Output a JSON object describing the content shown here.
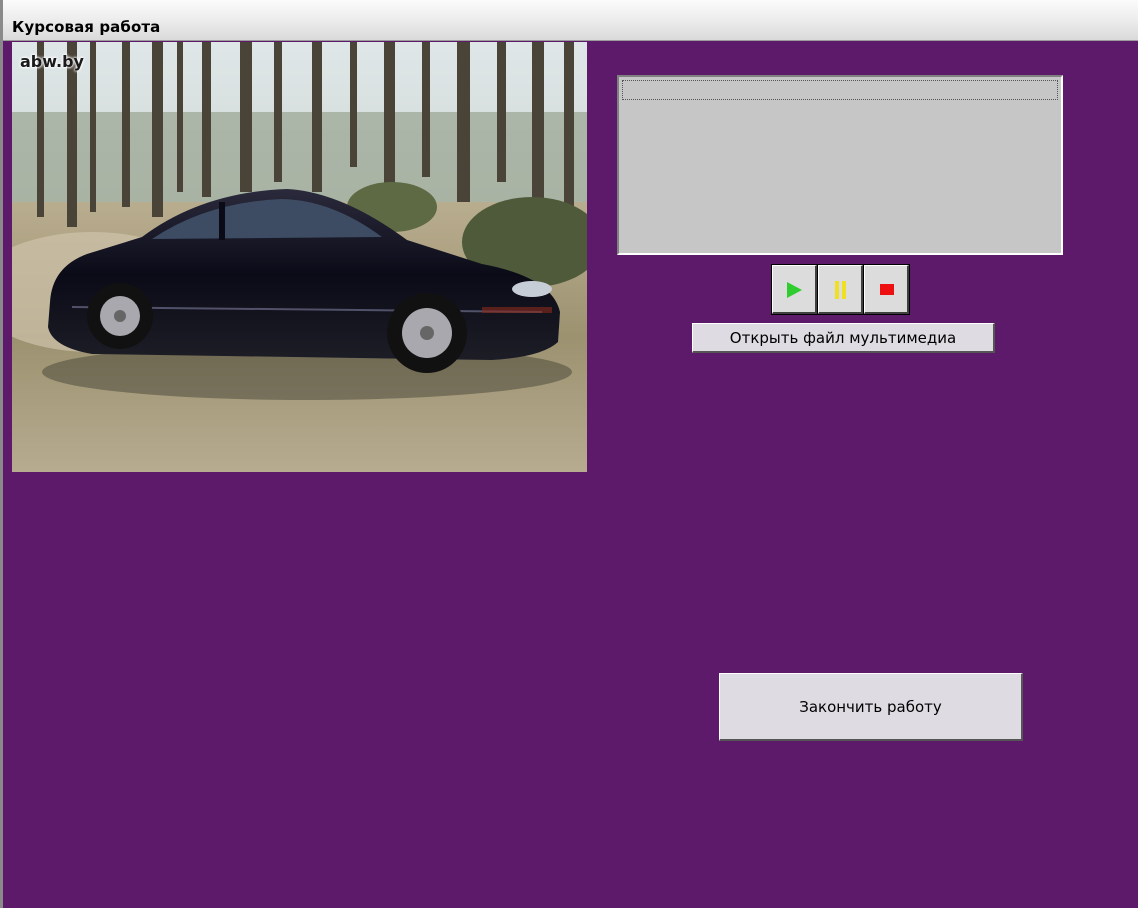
{
  "window": {
    "title": "Курсовая работа",
    "background": "#5e1a6a"
  },
  "photo": {
    "watermark": "abw.by",
    "description_icon": "car-photo"
  },
  "playlist": {
    "items": []
  },
  "media_controls": {
    "play_icon": "play-icon",
    "pause_icon": "pause-icon",
    "stop_icon": "stop-icon"
  },
  "buttons": {
    "open_media": "Открыть файл мультимедиа",
    "finish": "Закончить работу"
  }
}
